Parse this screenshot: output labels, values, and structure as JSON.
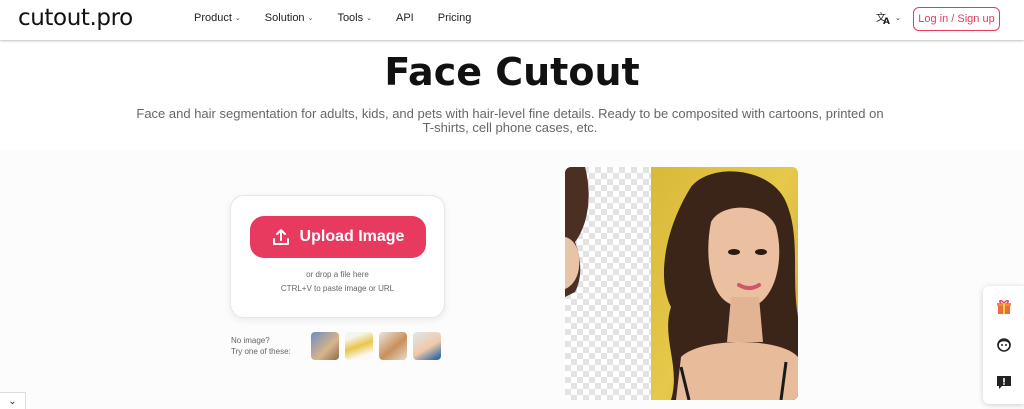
{
  "header": {
    "logo": "cutout.pro",
    "nav": [
      {
        "label": "Product",
        "dropdown": true
      },
      {
        "label": "Solution",
        "dropdown": true
      },
      {
        "label": "Tools",
        "dropdown": true
      },
      {
        "label": "API",
        "dropdown": false
      },
      {
        "label": "Pricing",
        "dropdown": false
      }
    ],
    "login_label": "Log in / Sign up"
  },
  "hero": {
    "title": "Face Cutout",
    "subtitle": "Face and hair segmentation for adults, kids, and pets with hair-level fine details. Ready to be composited with cartoons, printed on T-shirts, cell phone cases, etc."
  },
  "upload": {
    "button_label": "Upload Image",
    "drop_text": "or drop a file here",
    "paste_text": "CTRL+V to paste image or URL"
  },
  "samples": {
    "label_line1": "No image?",
    "label_line2": "Try one of these:"
  },
  "colors": {
    "accent": "#e8395f",
    "preview_background": "#e6c84a"
  },
  "icons": {
    "language": "translate-icon",
    "upload": "upload-icon",
    "gift": "gift-icon",
    "support": "headset-icon",
    "feedback": "feedback-icon",
    "collapse": "chevron-down-icon"
  }
}
